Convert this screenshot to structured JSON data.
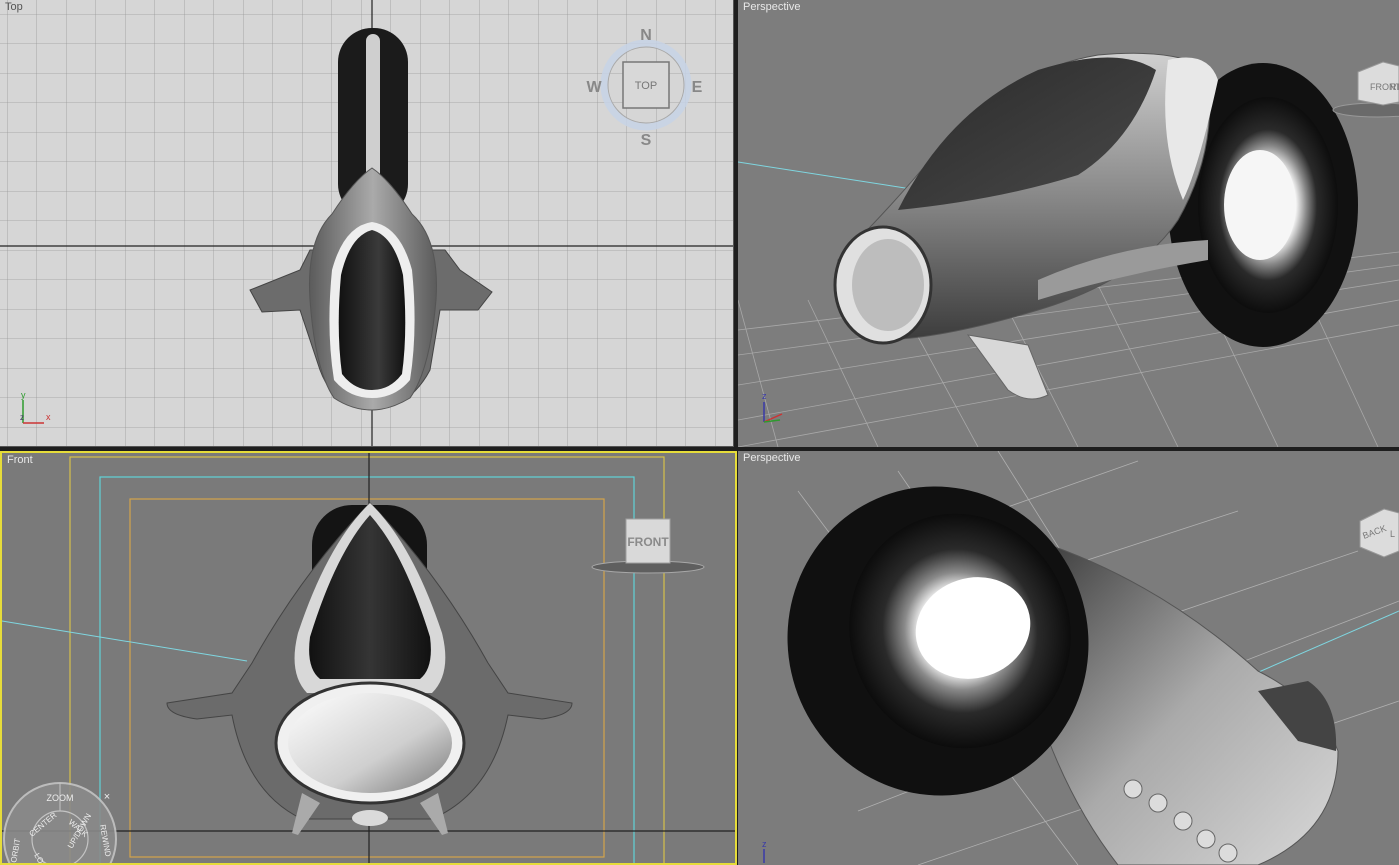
{
  "viewports": {
    "top": {
      "label": "Top"
    },
    "persp1": {
      "label": "Perspective"
    },
    "front": {
      "label": "Front"
    },
    "persp2": {
      "label": "Perspective"
    }
  },
  "compass": {
    "n": "N",
    "s": "S",
    "e": "E",
    "w": "W",
    "center": "TOP"
  },
  "viewcube": {
    "persp1_face": "FRONT",
    "persp1_side": "RI",
    "front_face": "FRONT",
    "persp2_face": "BACK",
    "persp2_side": "L"
  },
  "axis": {
    "x": "x",
    "y": "y",
    "z": "z"
  },
  "steering_wheel": {
    "zoom": "ZOOM",
    "orbit": "ORBIT",
    "center": "CENTER",
    "walk": "WALK",
    "rewind": "REWIND",
    "look": "LOOK",
    "updown": "UP/DOWN",
    "close": "×"
  },
  "colors": {
    "active_border": "#e6dc3a",
    "grid_top": "#999999",
    "safe_frame_outer": "#d4b04a",
    "safe_frame_mid": "#5fd3d8"
  }
}
